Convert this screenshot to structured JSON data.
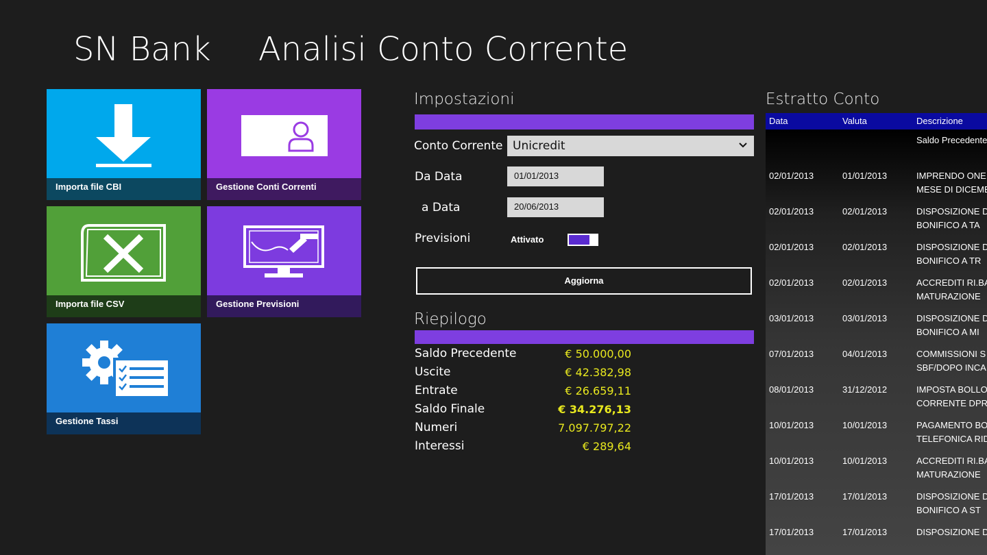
{
  "header": {
    "app_title": "SN Bank",
    "page_title": "Analisi Conto Corrente"
  },
  "tiles": [
    {
      "label": "Importa file CBI",
      "icon": "download-icon",
      "color": "#00a8ec",
      "label_bg": "#0c4860"
    },
    {
      "label": "Gestione Conti Correnti",
      "icon": "user-card-icon",
      "color": "#9a3be3",
      "label_bg": "#3f1a60"
    },
    {
      "label": "Importa file CSV",
      "icon": "excel-icon",
      "color": "#51a039",
      "label_bg": "#1e3d18"
    },
    {
      "label": "Gestione Previsioni",
      "icon": "monitor-pen-icon",
      "color": "#7d3bdf",
      "label_bg": "#321a5c"
    },
    {
      "label": "Gestione Tassi",
      "icon": "gear-checklist-icon",
      "color": "#1f7fd6",
      "label_bg": "#0d3358"
    }
  ],
  "settings": {
    "title": "Impostazioni",
    "account_label": "Conto Corrente",
    "account_value": "Unicredit",
    "from_label": "Da Data",
    "from_value": "01/01/2013",
    "to_label": "a Data",
    "to_value": "20/06/2013",
    "forecast_label": "Previsioni",
    "forecast_state": "Attivato",
    "forecast_on": true,
    "update_label": "Aggiorna"
  },
  "summary": {
    "title": "Riepilogo",
    "items": [
      {
        "label": "Saldo Precedente",
        "value": "€ 50.000,00"
      },
      {
        "label": "Uscite",
        "value": "€ 42.382,98"
      },
      {
        "label": "Entrate",
        "value": "€ 26.659,11"
      },
      {
        "label": "Saldo Finale",
        "value": "€ 34.276,13"
      },
      {
        "label": "Numeri",
        "value": "7.097.797,22"
      },
      {
        "label": "Interessi",
        "value": "€ 289,64"
      }
    ]
  },
  "statement": {
    "title": "Estratto Conto",
    "columns": [
      "Data",
      "Valuta",
      "Descrizione"
    ],
    "rows": [
      {
        "data": "",
        "valuta": "",
        "desc1": "Saldo Precedente",
        "desc2": ""
      },
      {
        "data": "02/01/2013",
        "valuta": "01/01/2013",
        "desc1": "IMPRENDO ONE",
        "desc2": "MESE DI DICEMBRE"
      },
      {
        "data": "02/01/2013",
        "valuta": "02/01/2013",
        "desc1": "DISPOSIZIONE DI",
        "desc2": "BONIFICO A  TA"
      },
      {
        "data": "02/01/2013",
        "valuta": "02/01/2013",
        "desc1": "DISPOSIZIONE DI",
        "desc2": "BONIFICO A  TR"
      },
      {
        "data": "02/01/2013",
        "valuta": "02/01/2013",
        "desc1": "ACCREDITI RI.BA.",
        "desc2": "MATURAZIONE"
      },
      {
        "data": "03/01/2013",
        "valuta": "03/01/2013",
        "desc1": "DISPOSIZIONE DI",
        "desc2": "BONIFICO A  MI"
      },
      {
        "data": "07/01/2013",
        "valuta": "04/01/2013",
        "desc1": "COMMISSIONI S",
        "desc2": "SBF/DOPO INCA"
      },
      {
        "data": "08/01/2013",
        "valuta": "31/12/2012",
        "desc1": "IMPOSTA BOLLO",
        "desc2": "CORRENTE DPR"
      },
      {
        "data": "10/01/2013",
        "valuta": "10/01/2013",
        "desc1": "PAGAMENTO BO",
        "desc2": "TELEFONICA RID"
      },
      {
        "data": "10/01/2013",
        "valuta": "10/01/2013",
        "desc1": "ACCREDITI RI.BA.",
        "desc2": "MATURAZIONE"
      },
      {
        "data": "17/01/2013",
        "valuta": "17/01/2013",
        "desc1": "DISPOSIZIONE DI",
        "desc2": "BONIFICO A  ST"
      },
      {
        "data": "17/01/2013",
        "valuta": "17/01/2013",
        "desc1": "DISPOSIZIONE DI",
        "desc2": ""
      }
    ]
  }
}
